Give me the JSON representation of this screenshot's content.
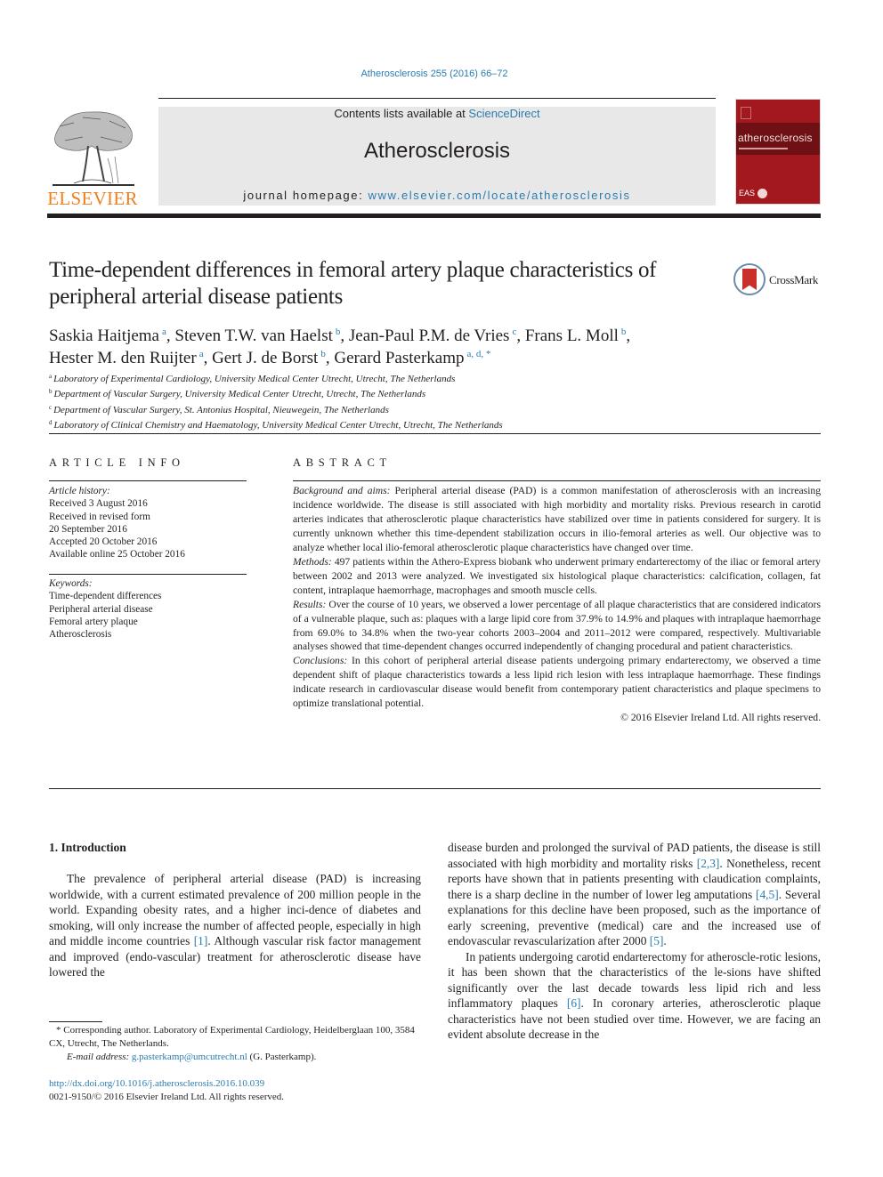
{
  "header": {
    "journal_ref": "Atherosclerosis 255 (2016) 66–72",
    "contents_prefix": "Contents lists available at ",
    "contents_link": "ScienceDirect",
    "journal_name": "Atherosclerosis",
    "homepage_prefix": "journal homepage: ",
    "homepage_link": "www.elsevier.com/locate/atherosclerosis",
    "publisher_logo": "ELSEVIER",
    "cover_title": "atherosclerosis",
    "cover_footer": "EAS",
    "colors": {
      "link": "#2a7cb0",
      "publisher_orange": "#f07f1d",
      "cover_red": "#a3181e",
      "header_gray": "#e8e8e8"
    }
  },
  "article": {
    "title": "Time-dependent differences in femoral artery plaque characteristics of peripheral arterial disease patients",
    "crossmark_label": "CrossMark",
    "authors": [
      {
        "name": "Saskia Haitjema",
        "aff": "a",
        "sep": ", "
      },
      {
        "name": "Steven T.W. van Haelst",
        "aff": "b",
        "sep": ", "
      },
      {
        "name": "Jean-Paul P.M. de Vries",
        "aff": "c",
        "sep": ", "
      },
      {
        "name": "Frans L. Moll",
        "aff": "b",
        "sep": ","
      },
      {
        "name": "Hester M. den Ruijter",
        "aff": "a",
        "sep": ", "
      },
      {
        "name": "Gert J. de Borst",
        "aff": "b",
        "sep": ", "
      },
      {
        "name": "Gerard Pasterkamp",
        "aff": "a, d, *",
        "sep": ""
      }
    ],
    "affiliations": [
      {
        "key": "a",
        "text": "Laboratory of Experimental Cardiology, University Medical Center Utrecht, Utrecht, The Netherlands"
      },
      {
        "key": "b",
        "text": "Department of Vascular Surgery, University Medical Center Utrecht, Utrecht, The Netherlands"
      },
      {
        "key": "c",
        "text": "Department of Vascular Surgery, St. Antonius Hospital, Nieuwegein, The Netherlands"
      },
      {
        "key": "d",
        "text": "Laboratory of Clinical Chemistry and Haematology, University Medical Center Utrecht, Utrecht, The Netherlands"
      }
    ]
  },
  "article_info": {
    "heading": "ARTICLE INFO",
    "history_label": "Article history:",
    "history": [
      "Received 3 August 2016",
      "Received in revised form",
      "20 September 2016",
      "Accepted 20 October 2016",
      "Available online 25 October 2016"
    ],
    "keywords_label": "Keywords:",
    "keywords": [
      "Time-dependent differences",
      "Peripheral arterial disease",
      "Femoral artery plaque",
      "Atherosclerosis"
    ]
  },
  "abstract": {
    "heading": "ABSTRACT",
    "sections": [
      {
        "label": "Background and aims:",
        "text": "Peripheral arterial disease (PAD) is a common manifestation of atherosclerosis with an increasing incidence worldwide. The disease is still associated with high morbidity and mortality risks. Previous research in carotid arteries indicates that atherosclerotic plaque characteristics have stabilized over time in patients considered for surgery. It is currently unknown whether this time-dependent stabilization occurs in ilio-femoral arteries as well. Our objective was to analyze whether local ilio-femoral atherosclerotic plaque characteristics have changed over time."
      },
      {
        "label": "Methods:",
        "text": "497 patients within the Athero-Express biobank who underwent primary endarterectomy of the iliac or femoral artery between 2002 and 2013 were analyzed. We investigated six histological plaque characteristics: calcification, collagen, fat content, intraplaque haemorrhage, macrophages and smooth muscle cells."
      },
      {
        "label": "Results:",
        "text": "Over the course of 10 years, we observed a lower percentage of all plaque characteristics that are considered indicators of a vulnerable plaque, such as: plaques with a large lipid core from 37.9% to 14.9% and plaques with intraplaque haemorrhage from 69.0% to 34.8% when the two-year cohorts 2003–2004 and 2011–2012 were compared, respectively. Multivariable analyses showed that time-dependent changes occurred independently of changing procedural and patient characteristics."
      },
      {
        "label": "Conclusions:",
        "text": "In this cohort of peripheral arterial disease patients undergoing primary endarterectomy, we observed a time dependent shift of plaque characteristics towards a less lipid rich lesion with less intraplaque haemorrhage. These findings indicate research in cardiovascular disease would benefit from contemporary patient characteristics and plaque specimens to optimize translational potential."
      }
    ],
    "copyright": "© 2016 Elsevier Ireland Ltd. All rights reserved."
  },
  "body": {
    "section_heading": "1.  Introduction",
    "left_paragraphs": [
      [
        {
          "t": "The prevalence of peripheral arterial disease (PAD) is increasing worldwide, with a current estimated prevalence of 200 million people in the world. Expanding obesity rates, and a higher inci-dence of diabetes and smoking, will only increase the number of affected people, especially in high and middle income countries "
        },
        {
          "ref": "[1]"
        },
        {
          "t": ". Although vascular risk factor management and improved (endo-vascular) treatment for atherosclerotic disease have lowered the"
        }
      ]
    ],
    "right_paragraphs": [
      [
        {
          "t": "disease burden and prolonged the survival of PAD patients, the disease is still associated with high morbidity and mortality risks "
        },
        {
          "ref": "[2,3]"
        },
        {
          "t": ". Nonetheless, recent reports have shown that in patients presenting with claudication complaints, there is a sharp decline in the number of lower leg amputations "
        },
        {
          "ref": "[4,5]"
        },
        {
          "t": ". Several explanations for this decline have been proposed, such as the importance of early screening, preventive (medical) care and the increased use of endovascular revascularization after 2000 "
        },
        {
          "ref": "[5]"
        },
        {
          "t": "."
        }
      ],
      [
        {
          "t": "In patients undergoing carotid endarterectomy for atheroscle-rotic lesions, it has been shown that the characteristics of the le-sions have shifted significantly over the last decade towards less lipid rich and less inflammatory plaques "
        },
        {
          "ref": "[6]"
        },
        {
          "t": ". In coronary arteries, atherosclerotic plaque characteristics have not been studied over time. However, we are facing an evident absolute decrease in the"
        }
      ]
    ]
  },
  "footnotes": {
    "corresponding": "* Corresponding author. Laboratory of Experimental Cardiology, Heidelberglaan 100, 3584 CX, Utrecht, The Netherlands.",
    "email_label": "E-mail address:",
    "email": "g.pasterkamp@umcutrecht.nl",
    "email_suffix": " (G. Pasterkamp).",
    "doi": "http://dx.doi.org/10.1016/j.atherosclerosis.2016.10.039",
    "issn_copyright": "0021-9150/© 2016 Elsevier Ireland Ltd. All rights reserved."
  }
}
